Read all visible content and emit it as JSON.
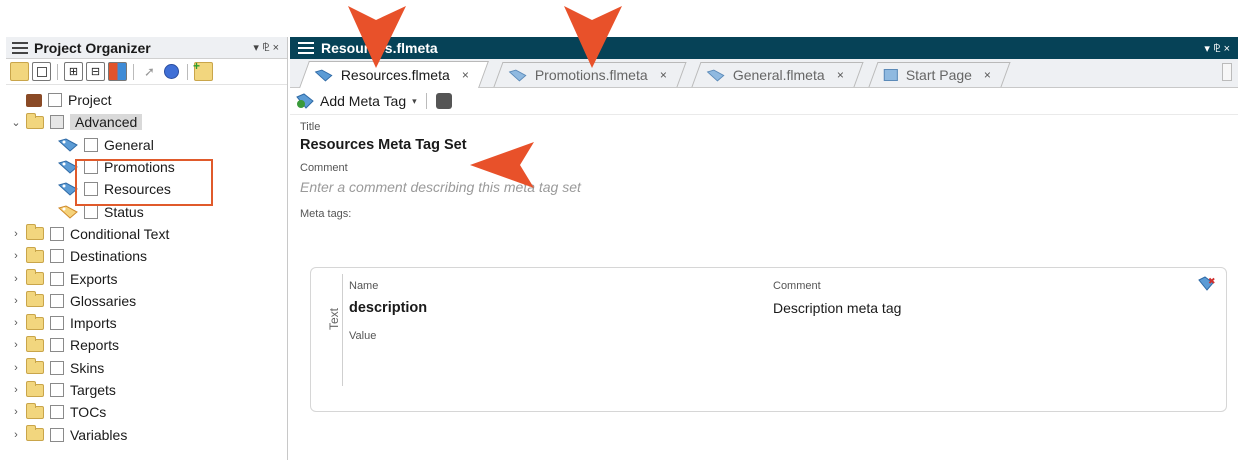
{
  "left_panel": {
    "title": "Project Organizer",
    "controls": "▾  ⅊  ×",
    "tree": [
      {
        "label": "Project",
        "kind": "project"
      },
      {
        "label": "Advanced",
        "kind": "folder",
        "expanded": true,
        "selected": true
      },
      {
        "label": "General",
        "kind": "metatag"
      },
      {
        "label": "Promotions",
        "kind": "metatag"
      },
      {
        "label": "Resources",
        "kind": "metatag"
      },
      {
        "label": "Status",
        "kind": "statustag"
      },
      {
        "label": "Conditional Text",
        "kind": "folder"
      },
      {
        "label": "Destinations",
        "kind": "folder"
      },
      {
        "label": "Exports",
        "kind": "folder"
      },
      {
        "label": "Glossaries",
        "kind": "folder"
      },
      {
        "label": "Imports",
        "kind": "folder"
      },
      {
        "label": "Reports",
        "kind": "folder"
      },
      {
        "label": "Skins",
        "kind": "folder"
      },
      {
        "label": "Targets",
        "kind": "folder"
      },
      {
        "label": "TOCs",
        "kind": "folder"
      },
      {
        "label": "Variables",
        "kind": "folder"
      }
    ]
  },
  "document": {
    "window_title": "Resources.flmeta",
    "controls": "▾  ⅊  ×",
    "tabs": [
      {
        "label": "Resources.flmeta",
        "active": true
      },
      {
        "label": "Promotions.flmeta",
        "active": false
      },
      {
        "label": "General.flmeta",
        "active": false
      },
      {
        "label": "Start Page",
        "active": false
      }
    ],
    "toolbar": {
      "add_meta_tag": "Add Meta Tag"
    },
    "title_label": "Title",
    "title_value": "Resources Meta Tag Set",
    "comment_label": "Comment",
    "comment_placeholder": "Enter a comment describing this meta tag set",
    "meta_tags_label": "Meta tags:",
    "meta_tag": {
      "type": "Text",
      "name_label": "Name",
      "name_value": "description",
      "comment_label": "Comment",
      "comment_value": "Description meta tag",
      "value_label": "Value"
    }
  },
  "colors": {
    "accent_dark": "#064257",
    "callout": "#e05a2b",
    "tag_blue": "#5b9bd5"
  }
}
